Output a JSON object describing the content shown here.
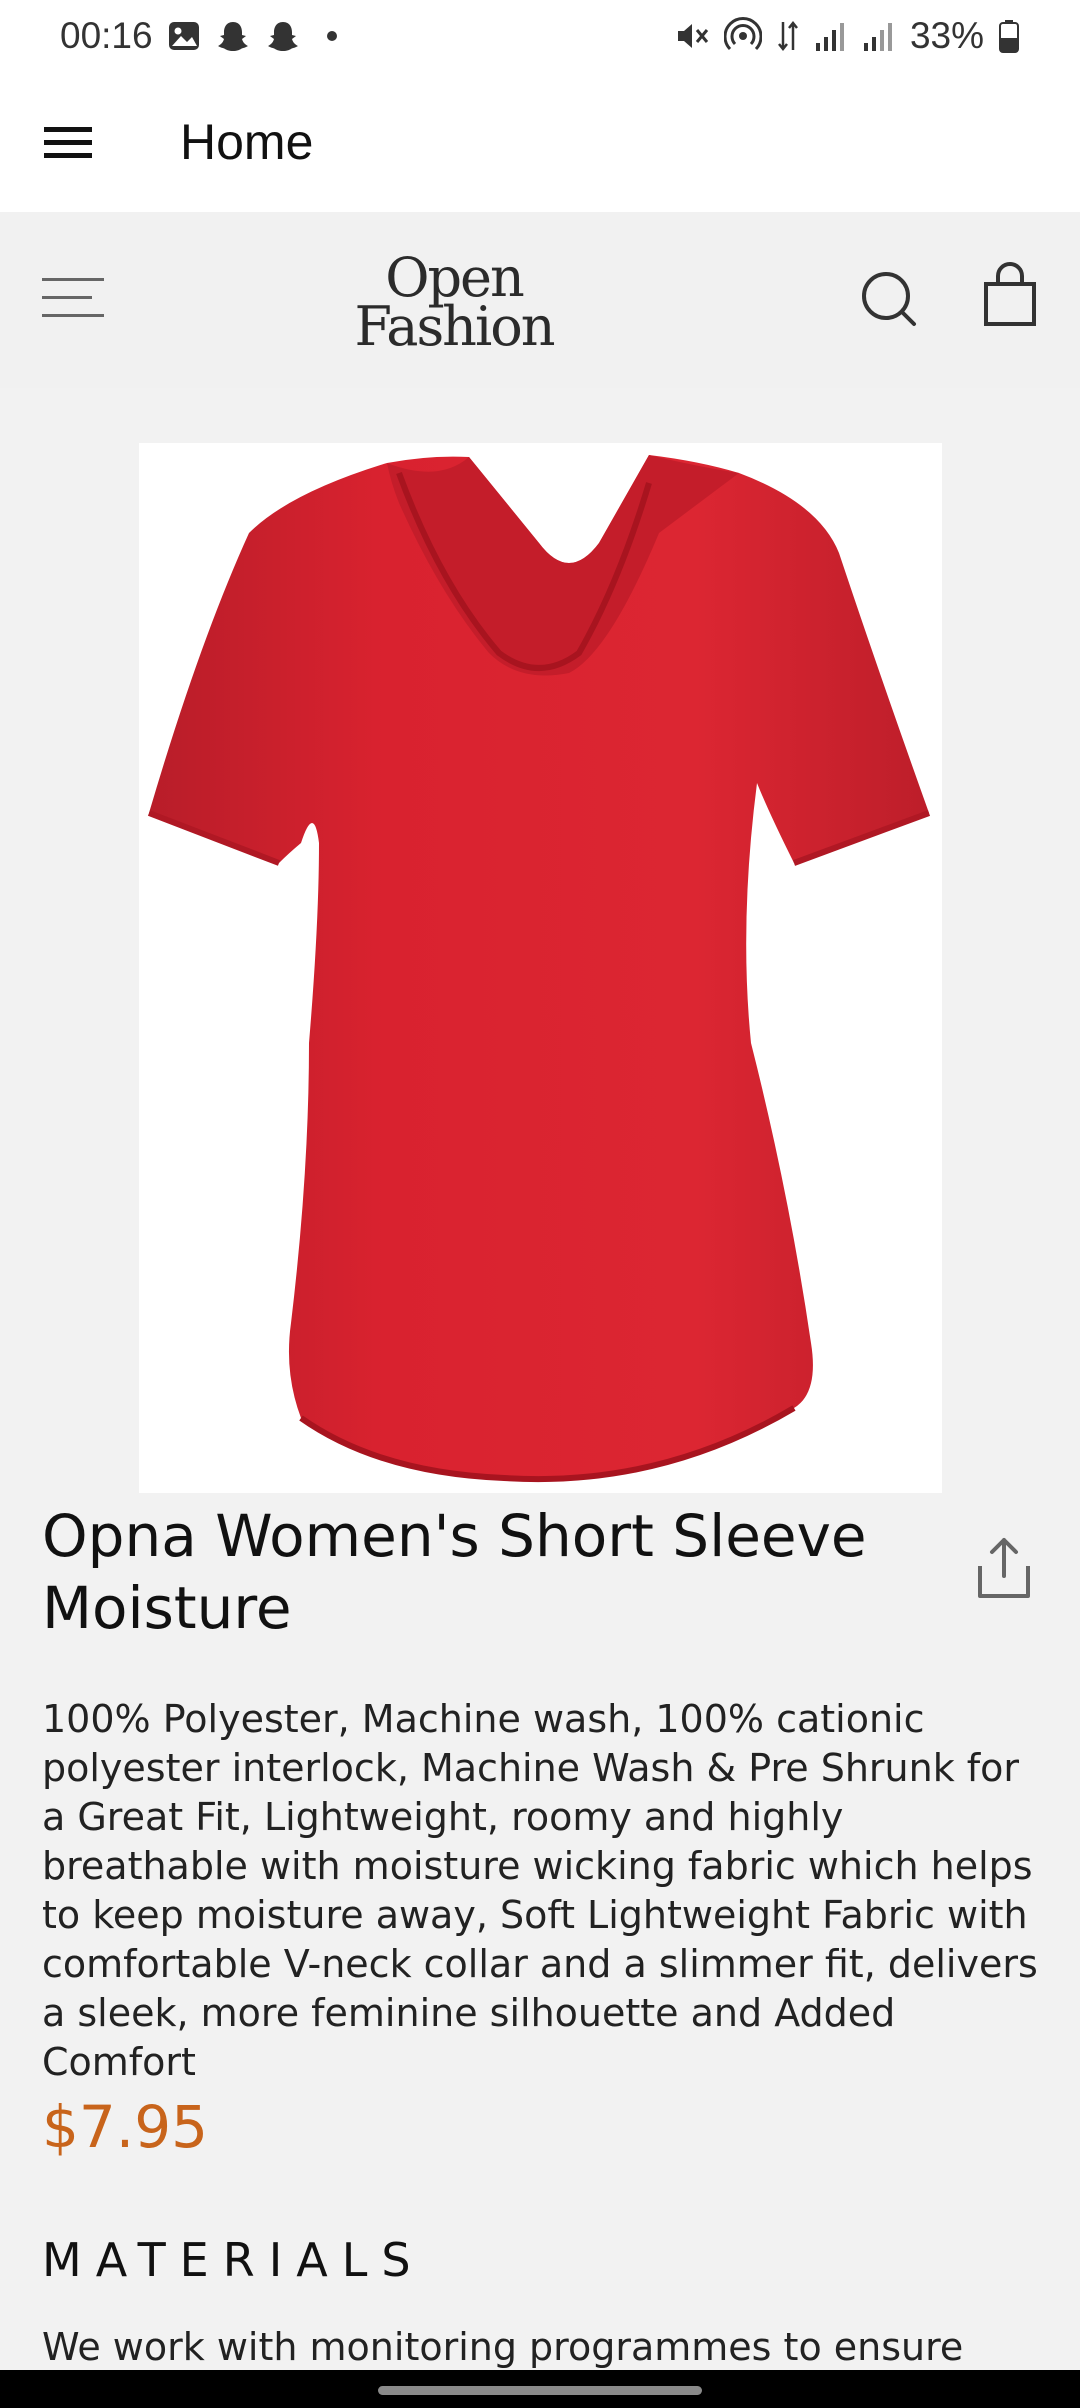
{
  "status_bar": {
    "time": "00:16",
    "battery": "33%",
    "icons": [
      "gallery-icon",
      "snapchat-icon",
      "snapchat-icon",
      "notification-dot",
      "mute-icon",
      "hotspot-icon",
      "data-icon",
      "signal-icon",
      "signal-icon",
      "battery-icon"
    ]
  },
  "app_bar": {
    "title": "Home",
    "menu_icon": "hamburger-menu-icon"
  },
  "store_header": {
    "logo_line1": "Open",
    "logo_line2": "Fashion",
    "menu_icon": "menu-icon",
    "search_icon": "search-icon",
    "bag_icon": "shopping-bag-icon"
  },
  "product": {
    "image_alt": "red v-neck t-shirt",
    "title": "Opna Women's Short Sleeve Moisture",
    "description": "100% Polyester, Machine wash, 100% cationic polyester interlock, Machine Wash & Pre Shrunk for a Great Fit, Lightweight, roomy and highly breathable with moisture wicking fabric which helps to keep moisture away, Soft Lightweight Fabric with comfortable V-neck collar and a slimmer fit, delivers a sleek, more feminine silhouette and Added Comfort",
    "price": "$7.95",
    "share_icon": "share-icon"
  },
  "materials": {
    "heading": "MATERIALS",
    "text": "We work with monitoring programmes to ensure"
  },
  "colors": {
    "accent_price": "#c8641b",
    "shirt": "#d9222f",
    "background": "#f2f2f2"
  }
}
